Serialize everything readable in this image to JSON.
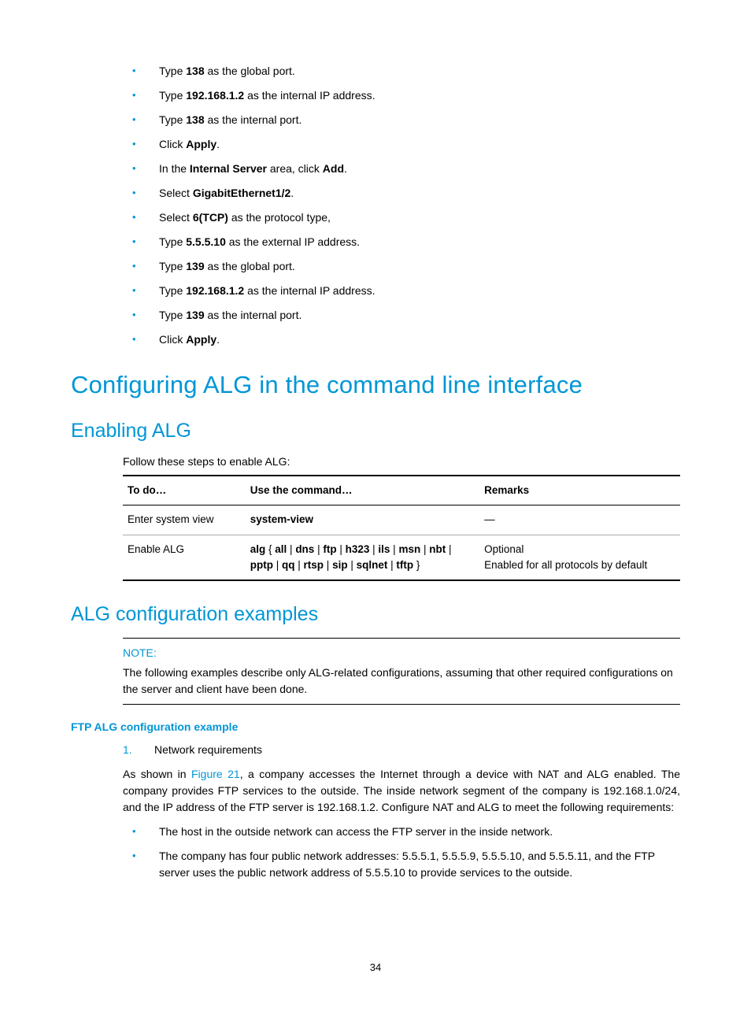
{
  "steps": [
    {
      "pre": "Type ",
      "bold": "138",
      "post": " as the global port."
    },
    {
      "pre": "Type ",
      "bold": "192.168.1.2",
      "post": " as the internal IP address."
    },
    {
      "pre": "Type ",
      "bold": "138",
      "post": " as the internal port."
    },
    {
      "pre": "Click ",
      "bold": "Apply",
      "post": "."
    },
    {
      "pre": "In the ",
      "bold": "Internal Server",
      "post": " area, click ",
      "bold2": "Add",
      "post2": "."
    },
    {
      "pre": "Select ",
      "bold": "GigabitEthernet1/2",
      "post": "."
    },
    {
      "pre": "Select ",
      "bold": "6(TCP)",
      "post": " as the protocol type,"
    },
    {
      "pre": "Type ",
      "bold": "5.5.5.10",
      "post": " as the external IP address."
    },
    {
      "pre": "Type ",
      "bold": "139",
      "post": " as the global port."
    },
    {
      "pre": "Type ",
      "bold": "192.168.1.2",
      "post": " as the internal IP address."
    },
    {
      "pre": "Type ",
      "bold": "139",
      "post": " as the internal port."
    },
    {
      "pre": "Click ",
      "bold": "Apply",
      "post": "."
    }
  ],
  "h1": "Configuring ALG in the command line interface",
  "h2a": "Enabling ALG",
  "intro": "Follow these steps to enable ALG:",
  "table": {
    "headers": [
      "To do…",
      "Use the command…",
      "Remarks"
    ],
    "rows": [
      {
        "todo": "Enter system view",
        "cmd_plain": "",
        "cmd_bold": "system-view",
        "remarks": "—"
      },
      {
        "todo": "Enable ALG",
        "cmd_segments": [
          {
            "b": "alg"
          },
          {
            "t": " { "
          },
          {
            "b": "all"
          },
          {
            "t": " | "
          },
          {
            "b": "dns"
          },
          {
            "t": " | "
          },
          {
            "b": "ftp"
          },
          {
            "t": " | "
          },
          {
            "b": "h323"
          },
          {
            "t": " | "
          },
          {
            "b": "ils"
          },
          {
            "t": " | "
          },
          {
            "b": "msn"
          },
          {
            "t": " | "
          },
          {
            "b": "nbt"
          },
          {
            "t": " | "
          },
          {
            "b": "pptp"
          },
          {
            "t": " | "
          },
          {
            "b": "qq"
          },
          {
            "t": " | "
          },
          {
            "b": "rtsp"
          },
          {
            "t": " | "
          },
          {
            "b": "sip"
          },
          {
            "t": " | "
          },
          {
            "b": "sqlnet"
          },
          {
            "t": " | "
          },
          {
            "b": "tftp"
          },
          {
            "t": " }"
          }
        ],
        "remarks_lines": [
          "Optional",
          "Enabled for all protocols by default"
        ]
      }
    ]
  },
  "h2b": "ALG configuration examples",
  "note_label": "NOTE:",
  "note_text": "The following examples describe only ALG-related configurations, assuming that other required configurations on the server and client have been done.",
  "h3": "FTP ALG configuration example",
  "numbered": [
    {
      "n": "1.",
      "text": "Network requirements"
    }
  ],
  "para1_pre": "As shown in ",
  "para1_link": "Figure 21",
  "para1_post": ", a company accesses the Internet through a device with NAT and ALG enabled. The company provides FTP services to the outside. The inside network segment of the company is 192.168.1.0/24, and the IP address of the FTP server is 192.168.1.2. Configure NAT and ALG to meet the following requirements:",
  "req_bullets": [
    "The host in the outside network can access the FTP server in the inside network.",
    "The company has four public network addresses: 5.5.5.1, 5.5.5.9, 5.5.5.10, and 5.5.5.11, and the FTP server uses the public network address of 5.5.5.10 to provide services to the outside."
  ],
  "page_number": "34"
}
